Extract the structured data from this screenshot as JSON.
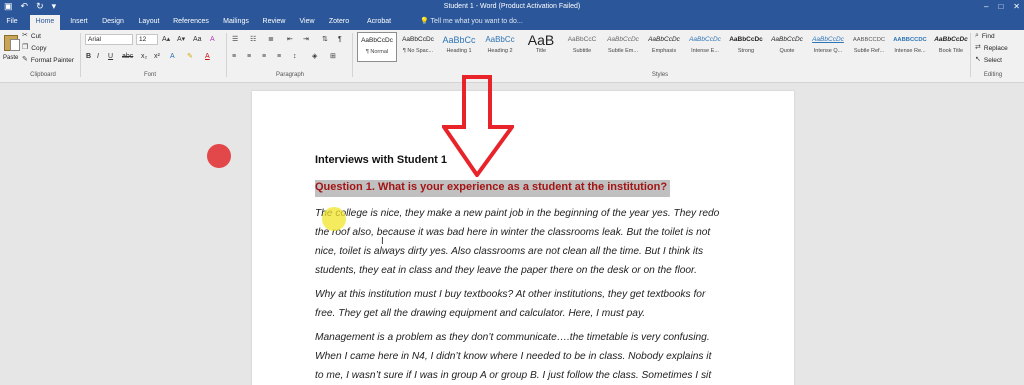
{
  "title_bar": {
    "document_title": "Student 1 - Word (Product Activation Failed)",
    "qat_icons": [
      "save-icon",
      "undo-icon",
      "redo-icon",
      "customize-icon"
    ]
  },
  "tabs": {
    "file": "File",
    "home": "Home",
    "insert": "Insert",
    "design": "Design",
    "layout": "Layout",
    "references": "References",
    "mailings": "Mailings",
    "review": "Review",
    "view": "View",
    "zotero": "Zotero",
    "acrobat": "Acrobat",
    "tell_me": "Tell me what you want to do..."
  },
  "clipboard": {
    "paste": "Paste",
    "cut": "Cut",
    "copy": "Copy",
    "format_painter": "Format Painter",
    "label": "Clipboard"
  },
  "font": {
    "name": "Arial",
    "size": "12",
    "label": "Font"
  },
  "paragraph": {
    "label": "Paragraph"
  },
  "styles": {
    "label": "Styles",
    "items": [
      {
        "sample": "AaBbCcDc",
        "name": "¶ Normal"
      },
      {
        "sample": "AaBbCcDc",
        "name": "¶ No Spac..."
      },
      {
        "sample": "AaBbCc",
        "name": "Heading 1"
      },
      {
        "sample": "AaBbCc",
        "name": "Heading 2"
      },
      {
        "sample": "AaB",
        "name": "Title"
      },
      {
        "sample": "AaBbCcC",
        "name": "Subtitle"
      },
      {
        "sample": "AaBbCcDc",
        "name": "Subtle Em..."
      },
      {
        "sample": "AaBbCcDc",
        "name": "Emphasis"
      },
      {
        "sample": "AaBbCcDc",
        "name": "Intense E..."
      },
      {
        "sample": "AaBbCcDc",
        "name": "Strong"
      },
      {
        "sample": "AaBbCcDc",
        "name": "Quote"
      },
      {
        "sample": "AaBbCcDc",
        "name": "Intense Q..."
      },
      {
        "sample": "AABBCCDC",
        "name": "Subtle Ref..."
      },
      {
        "sample": "AABBCCDC",
        "name": "Intense Re..."
      },
      {
        "sample": "AaBbCcDc",
        "name": "Book Title"
      }
    ]
  },
  "editing": {
    "find": "Find",
    "replace": "Replace",
    "select": "Select",
    "label": "Editing"
  },
  "document": {
    "heading": "Interviews with Student 1",
    "question": "Question 1. What is your experience as a student at the institution?",
    "paragraphs": [
      [
        "The college is nice, they make a new paint job in the beginning of the year yes. They redo",
        "the roof also, because it was bad here in winter the classrooms leak. But the toilet is not",
        "nice, toilet is always dirty yes. Also classrooms are not clean all the time. But I think its",
        "students, they eat in class and they leave the paper there on the desk or on the floor."
      ],
      [
        "Why at this institution must I buy textbooks? At other institutions, they get textbooks for",
        "free. They get all the drawing equipment and calculator. Here, I must pay."
      ],
      [
        " Management is a problem as they don’t communicate….the timetable is very confusing.",
        "When I came here in N4, I didn’t know where I needed to be in class. Nobody explains it",
        "to me, I wasn’t sure if I was in group A or group B. I just follow the class. Sometimes I sit"
      ]
    ]
  },
  "annotations": {
    "red_dot_color": "#e2474a",
    "cursor_highlight_color": "#f0e628",
    "arrow_color": "#e8232a"
  }
}
